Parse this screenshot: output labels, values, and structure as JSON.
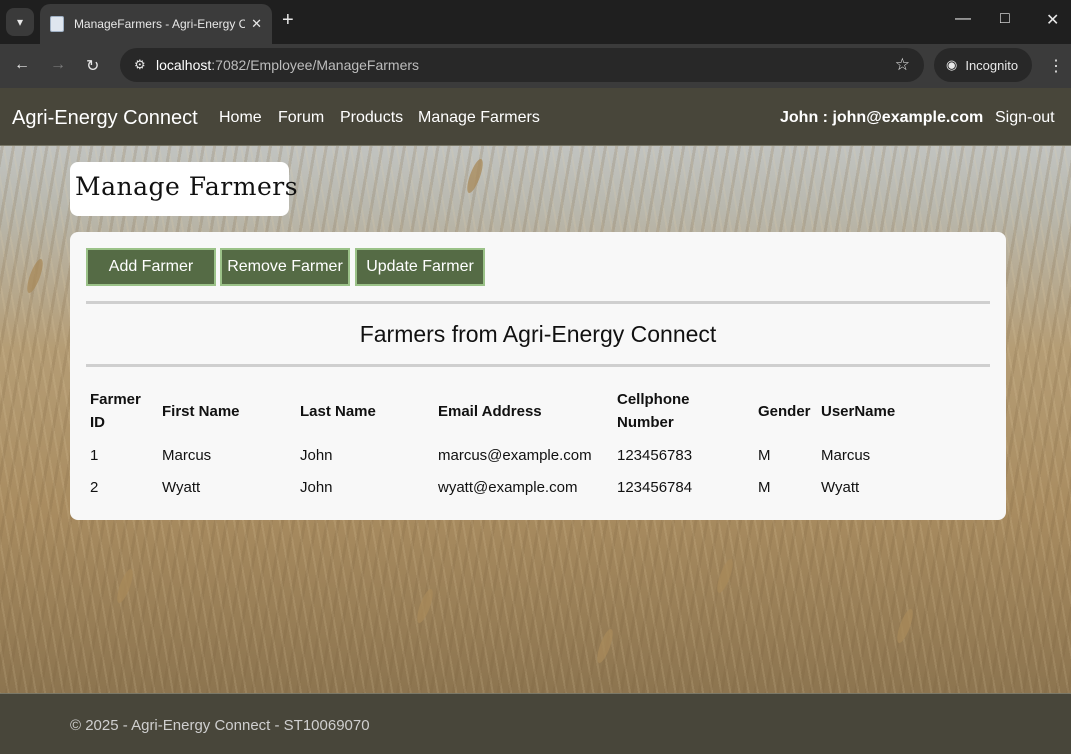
{
  "browser": {
    "tab_title": "ManageFarmers - Agri-Energy Connect",
    "url_host": "localhost",
    "url_path": ":7082/Employee/ManageFarmers",
    "incognito_label": "Incognito"
  },
  "navbar": {
    "brand": "Agri-Energy Connect",
    "links": [
      "Home",
      "Forum",
      "Products",
      "Manage Farmers"
    ],
    "user": "John : john@example.com",
    "signout": "Sign-out"
  },
  "page": {
    "heading": "Manage Farmers",
    "buttons": {
      "add": "Add Farmer",
      "remove": "Remove Farmer",
      "update": "Update Farmer"
    },
    "section_title": "Farmers from Agri-Energy Connect",
    "table": {
      "headers": [
        "Farmer\nID",
        "First Name",
        "Last Name",
        "Email Address",
        "Cellphone\nNumber",
        "Gender",
        "UserName"
      ],
      "rows": [
        [
          "1",
          "Marcus",
          "John",
          "marcus@example.com",
          "123456783",
          "M",
          "Marcus"
        ],
        [
          "2",
          "Wyatt",
          "John",
          "wyatt@example.com",
          "123456784",
          "M",
          "Wyatt"
        ]
      ]
    }
  },
  "footer": {
    "text": "© 2025 - Agri-Energy Connect - ST10069070"
  },
  "colors": {
    "navbar_bg": "#48463a",
    "button_bg": "#556b45",
    "button_border": "#9bc288"
  },
  "icons": [
    "tab-search-icon",
    "page-favicon-icon",
    "close-tab-icon",
    "new-tab-icon",
    "minimize-icon",
    "maximize-icon",
    "close-window-icon",
    "back-icon",
    "forward-icon",
    "reload-icon",
    "site-info-icon",
    "bookmark-star-icon",
    "incognito-icon",
    "browser-menu-icon"
  ]
}
